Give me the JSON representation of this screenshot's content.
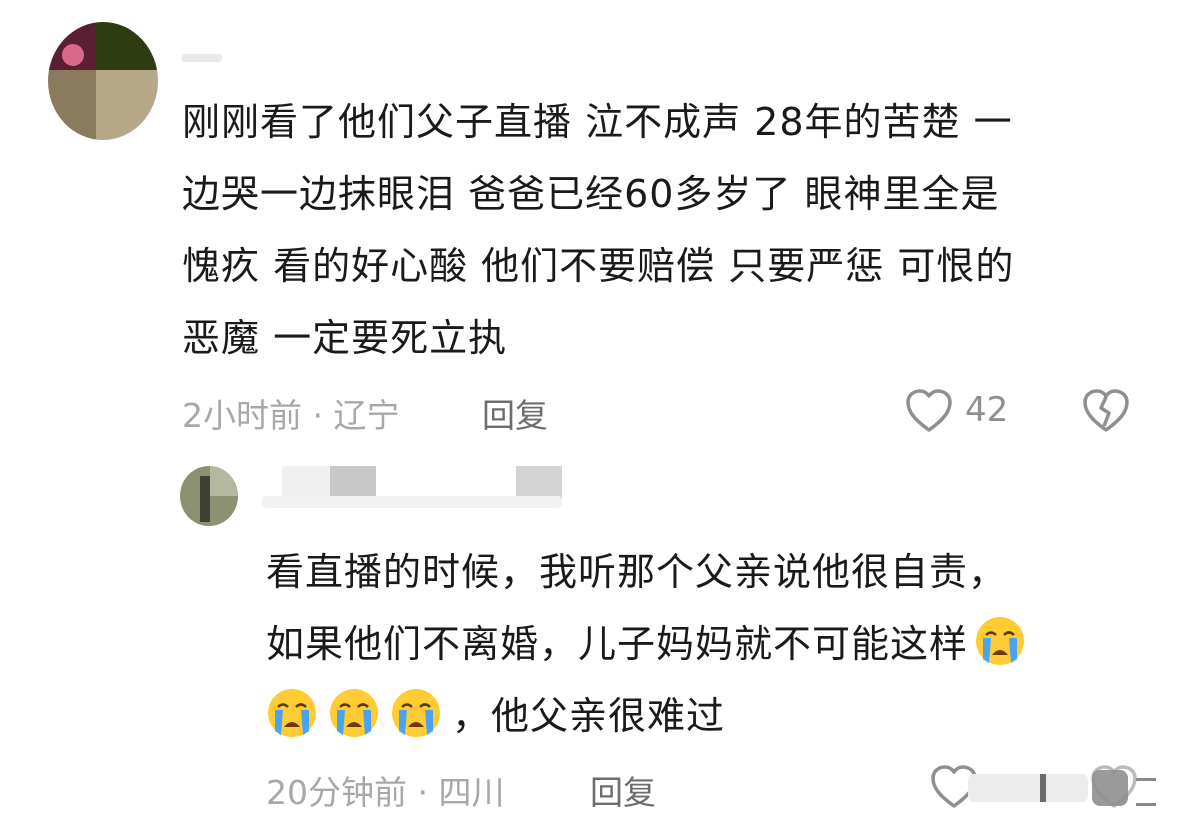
{
  "colors": {
    "text": "#1a1a1a",
    "meta": "#a8a8a8",
    "reply": "#6d6d6d",
    "icon": "#8f8f8f"
  },
  "comment_main": {
    "lines": [
      "刚刚看了他们父子直播 泣不成声 28年的苦楚 一",
      "边哭一边抹眼泪 爸爸已经60多岁了 眼神里全是",
      "愧疚 看的好心酸 他们不要赔偿 只要严惩 可恨的",
      "恶魔 一定要死立执"
    ],
    "time_location": "2小时前 · 辽宁",
    "reply_label": "回复",
    "like_count": "42",
    "icons": [
      "heart-icon",
      "broken-heart-icon"
    ]
  },
  "comment_reply": {
    "lines": [
      "看直播的时候，我听那个父亲说他很自责，",
      "如果他们不离婚，儿子妈妈就不可能这样"
    ],
    "line3_text": "，他父亲很难过",
    "emoji_count": 4,
    "emoji_name": "loudly-crying-face",
    "time_location": "20分钟前 · 四川",
    "reply_label": "回复",
    "icons": [
      "heart-icon",
      "broken-heart-icon"
    ]
  }
}
